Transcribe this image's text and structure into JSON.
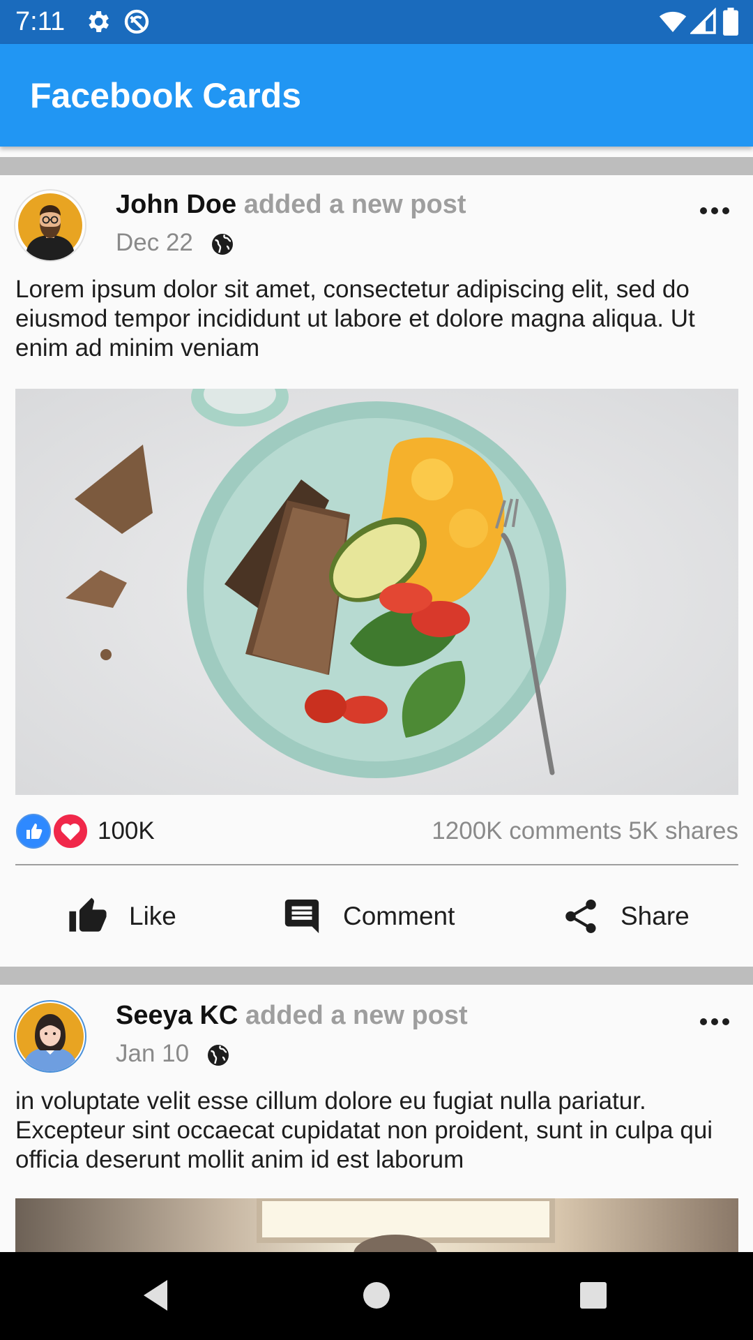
{
  "status_bar": {
    "time": "7:11",
    "left_icons": [
      "gear-icon",
      "sync-disabled-icon"
    ],
    "right_icons": [
      "wifi-icon",
      "signal-icon",
      "battery-icon"
    ],
    "color": "#1a6bbd"
  },
  "app_bar": {
    "title": "Facebook Cards",
    "color": "#2196f3"
  },
  "posts": [
    {
      "author": "John Doe",
      "action": "added a new post",
      "date": "Dec 22",
      "privacy_icon": "globe-icon",
      "text": "Lorem ipsum dolor sit amet, consectetur adipiscing elit, sed do eiusmod tempor incididunt ut labore et dolore magna aliqua. Ut enim ad minim veniam",
      "image": "breakfast plate with toast, avocado, eggs and salad",
      "reactions": [
        "like-reaction-icon",
        "love-reaction-icon"
      ],
      "reaction_count": "100K",
      "comments": "1200K comments",
      "shares": "5K shares",
      "buttons": {
        "like": "Like",
        "comment": "Comment",
        "share": "Share"
      }
    },
    {
      "author": "Seeya KC",
      "action": "added a new post",
      "date": "Jan 10",
      "privacy_icon": "globe-icon",
      "text": "in voluptate velit esse cillum dolore eu fugiat nulla pariatur. Excepteur sint occaecat cupidatat non proident, sunt in culpa qui officia deserunt mollit anim id est laborum",
      "image": "sunlit window interior"
    }
  ],
  "nav_bar": {
    "buttons": [
      "back-icon",
      "home-icon",
      "recents-icon"
    ]
  },
  "colors": {
    "like_blue": "#2e89ff",
    "love_red": "#f0284a",
    "divider": "#bdbdbd"
  }
}
